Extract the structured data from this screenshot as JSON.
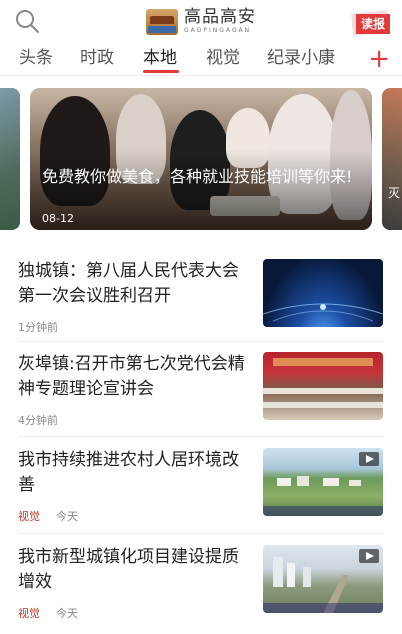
{
  "header": {
    "logo_cn": "高品高安",
    "logo_en": "GAOPINGAOAN",
    "newspaper_label": "读报",
    "icons": {
      "search": "search-icon",
      "newspaper": "newspaper-icon",
      "add": "plus-icon"
    }
  },
  "tabs": [
    {
      "label": "头条",
      "active": false
    },
    {
      "label": "时政",
      "active": false
    },
    {
      "label": "本地",
      "active": true
    },
    {
      "label": "视觉",
      "active": false
    },
    {
      "label": "纪录小康",
      "active": false
    }
  ],
  "plus_label": "+",
  "banner": {
    "title": "免费教你做美食，各种就业技能培训等你来!",
    "date": "08-12"
  },
  "news": [
    {
      "title": "独城镇：第八届人民代表大会第一次会议胜利召开",
      "tag": "",
      "time": "1分钟前"
    },
    {
      "title": "灰埠镇:召开市第七次党代会精神专题理论宣讲会",
      "tag": "",
      "time": "4分钟前"
    },
    {
      "title": "我市持续推进农村人居环境改善",
      "tag": "视觉",
      "time": "今天"
    },
    {
      "title": "我市新型城镇化项目建设提质增效",
      "tag": "视觉",
      "time": "今天"
    }
  ],
  "colors": {
    "accent": "#e43a3a",
    "tag": "#c0392b"
  }
}
